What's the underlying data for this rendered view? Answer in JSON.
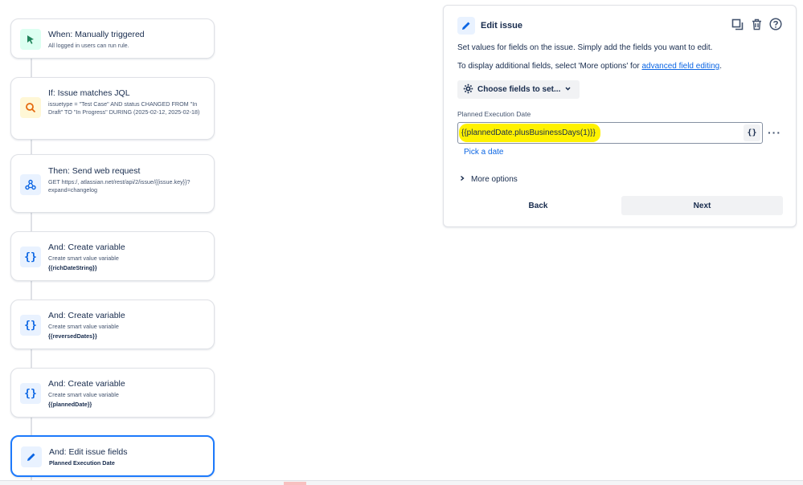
{
  "flow": {
    "cards": [
      {
        "title": "When: Manually triggered",
        "sub": "All logged in users can run rule.",
        "icon": "cursor-click-icon"
      },
      {
        "title": "If: Issue matches JQL",
        "sub": "issuetype = \"Test Case\" AND status CHANGED FROM \"In Draft\" TO \"In Progress\" DURING (2025-02-12, 2025-02-18)",
        "icon": "search-icon"
      },
      {
        "title": "Then: Send web request",
        "sub": "GET https:/,          atlassian.net/rest/api/2/issue/{{issue.key}}?expand=changelog",
        "icon": "webhook-icon"
      },
      {
        "title": "And: Create variable",
        "sub": "Create smart value variable",
        "var": "{{richDateString}}",
        "icon": "braces-icon"
      },
      {
        "title": "And: Create variable",
        "sub": "Create smart value variable",
        "var": "{{reversedDates}}",
        "icon": "braces-icon"
      },
      {
        "title": "And: Create variable",
        "sub": "Create smart value variable",
        "var": "{{plannedDate}}",
        "icon": "braces-icon"
      },
      {
        "title": "And: Edit issue fields",
        "sub": "Planned Execution Date",
        "icon": "pencil-icon"
      }
    ]
  },
  "panel": {
    "title": "Edit issue",
    "desc1": "Set values for fields on the issue. Simply add the fields you want to edit.",
    "desc2_prefix": "To display additional fields, select 'More options' for ",
    "desc2_link": "advanced field editing",
    "desc2_suffix": ".",
    "choose_label": "Choose fields to set...",
    "field_label": "Planned Execution Date",
    "field_value": "{{plannedDate.plusBusinessDays(1)}}",
    "smart_btn": "{}",
    "pick_date": "Pick a date",
    "more_options": "More options",
    "back": "Back",
    "next": "Next"
  },
  "colors": {
    "highlight": "#fff200",
    "link": "#0c66e4",
    "selected_border": "#1d7afc"
  }
}
